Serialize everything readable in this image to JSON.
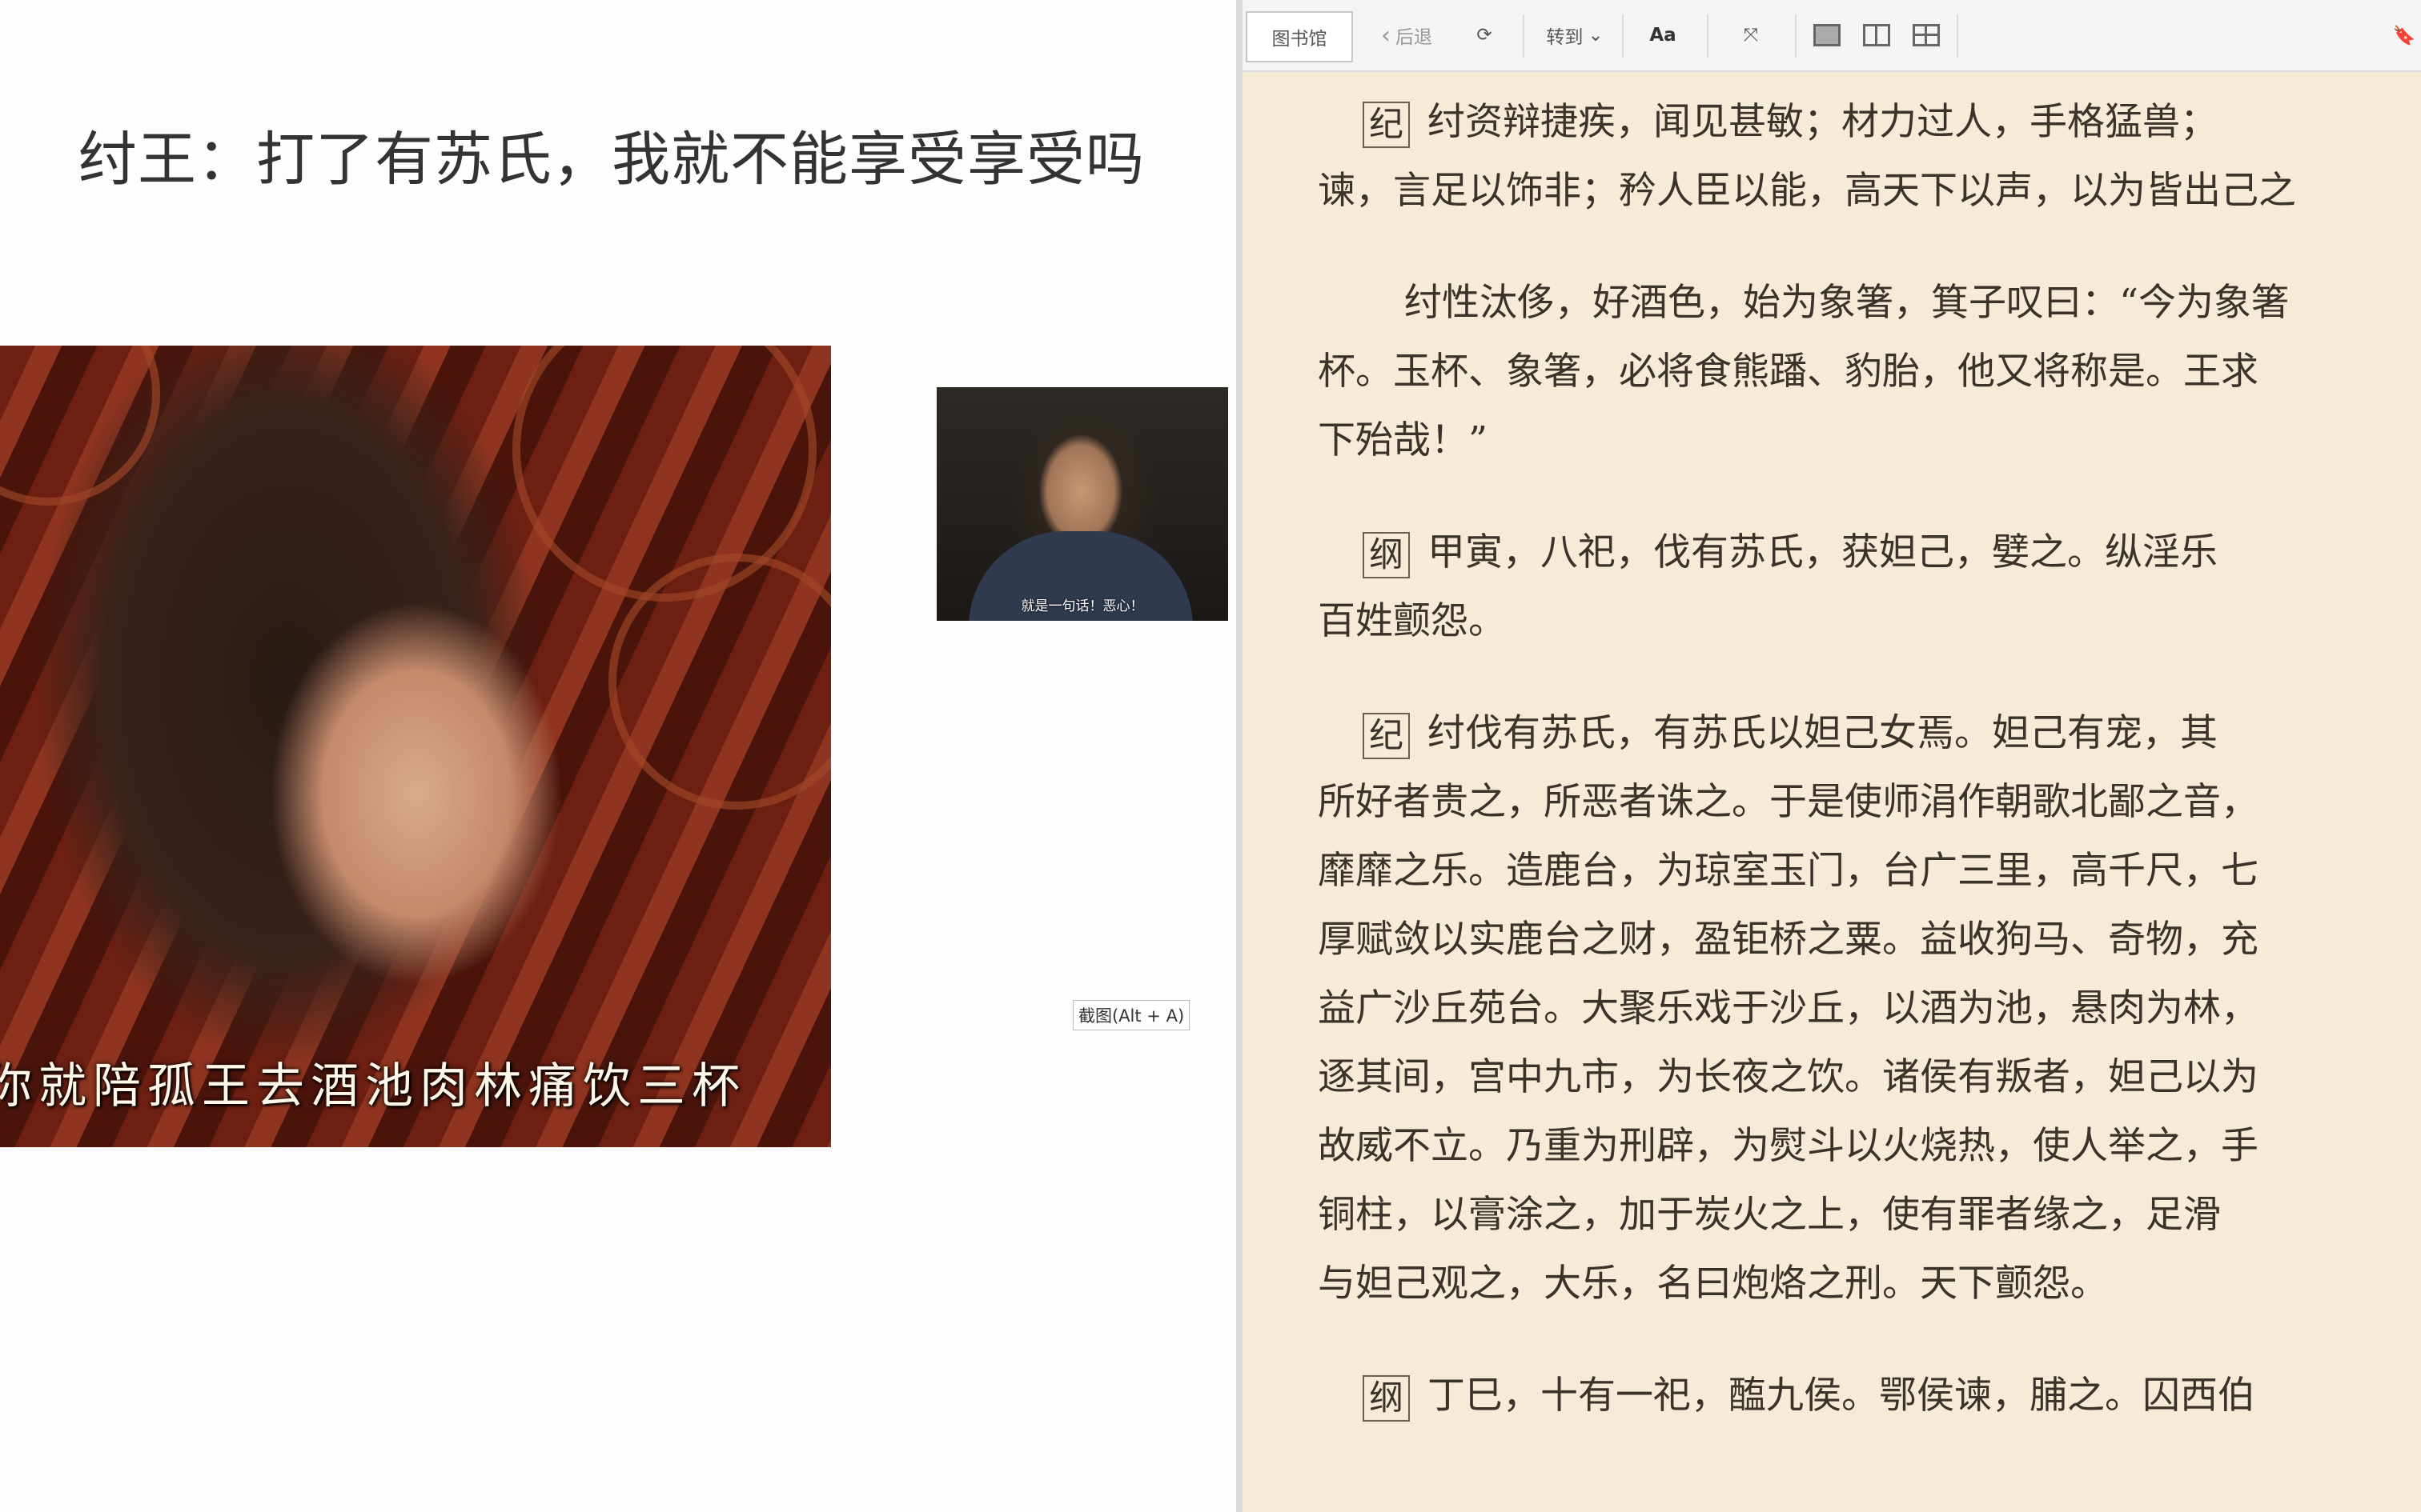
{
  "slide": {
    "title": "纣王：打了有苏氏，我就不能享受享受吗",
    "main_image_caption": "你就陪孤王去酒池肉林痛饮三杯",
    "small_image_caption": "就是一句话！恶心！",
    "screenshot_hint": "截图(Alt + A)"
  },
  "toolbar": {
    "library_label": "图书馆",
    "back_label": "后退",
    "refresh_icon": "⟳",
    "goto_label": "转到",
    "goto_chevron": "⌄",
    "font_label": "Aa",
    "fullscreen_icon": "⤧",
    "bookmark_icon": "🔖"
  },
  "reader": {
    "paragraphs": [
      {
        "tag": "纪",
        "lines": [
          "纣资辩捷疾，闻见甚敏；材力过人，手格猛兽；",
          "谏，言足以饰非；矜人臣以能，高天下以声，以为皆出己之"
        ]
      },
      {
        "tag": "",
        "lines": [
          "纣性汰侈，好酒色，始为象箸，箕子叹曰：“今为象箸",
          "杯。玉杯、象箸，必将食熊蹯、豹胎，他又将称是。王求",
          "下殆哉！”"
        ]
      },
      {
        "tag": "纲",
        "lines": [
          "甲寅，八祀，伐有苏氏，获妲己，嬖之。纵淫乐",
          "百姓颤怨。"
        ]
      },
      {
        "tag": "纪",
        "lines": [
          "纣伐有苏氏，有苏氏以妲己女焉。妲己有宠，其",
          "所好者贵之，所恶者诛之。于是使师涓作朝歌北鄙之音，",
          "靡靡之乐。造鹿台，为琼室玉门，台广三里，高千尺，七",
          "厚赋敛以实鹿台之财，盈钜桥之粟。益收狗马、奇物，充",
          "益广沙丘苑台。大聚乐戏于沙丘，以酒为池，悬肉为林，",
          "逐其间，宫中九市，为长夜之饮。诸侯有叛者，妲己以为",
          "故威不立。乃重为刑辟，为熨斗以火烧热，使人举之，手",
          "铜柱，以膏涂之，加于炭火之上，使有罪者缘之，足滑",
          "与妲己观之，大乐，名曰炮烙之刑。天下颤怨。"
        ]
      },
      {
        "tag": "纲",
        "lines": [
          "丁巳，十有一祀，醢九侯。鄂侯谏，脯之。囚西伯"
        ]
      }
    ]
  },
  "colors": {
    "reader_bg": "#f5ebd6",
    "reader_text": "#3a3329",
    "toolbar_bg": "#f4f4f4"
  }
}
